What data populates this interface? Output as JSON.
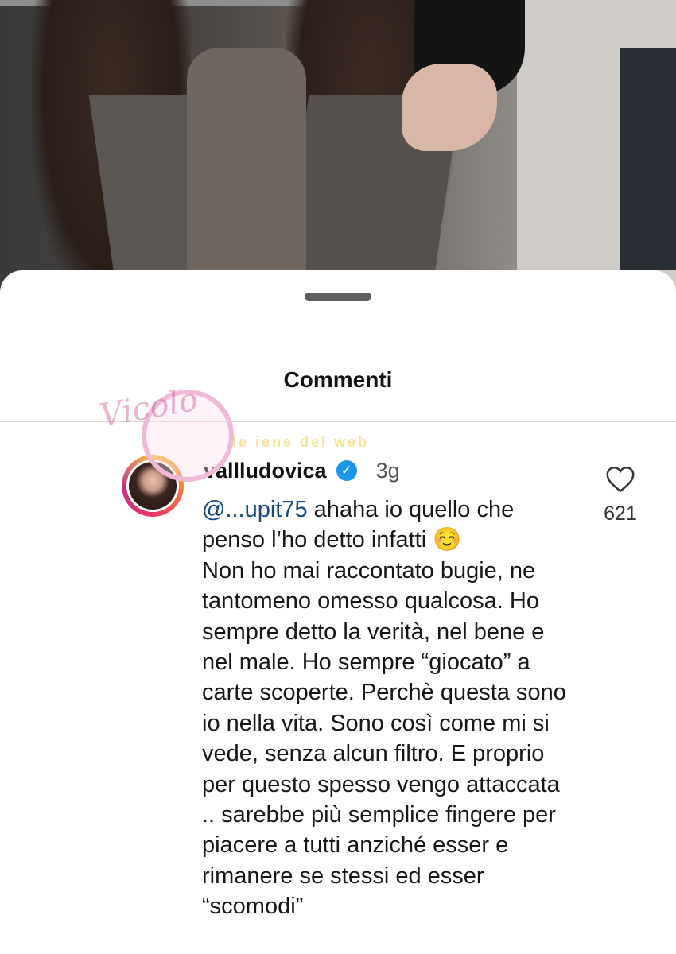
{
  "sheet": {
    "title": "Commenti"
  },
  "comment": {
    "username": "vallludovica",
    "verified_icon": "verified-check-icon",
    "time": "3g",
    "mention": "@...upit75",
    "text": " ahaha io quello che penso l’ho detto infatti ☺️\nNon ho mai raccontato bugie, ne tantomeno omesso qualcosa. Ho sempre detto la verità, nel bene e nel male. Ho sempre “giocato” a carte scoperte. Perchè questa sono io nella vita. Sono così come mi si vede, senza alcun filtro. E proprio per questo spesso vengo attaccata .. sarebbe più semplice fingere per piacere a tutti anziché esser e rimanere se stessi ed esser “scomodi”",
    "likes": "621"
  },
  "watermarks": {
    "vicolo": "Vicolo",
    "web": "le iene del web"
  },
  "colors": {
    "verified": "#1c96e8",
    "mention": "#1a4a7a"
  }
}
